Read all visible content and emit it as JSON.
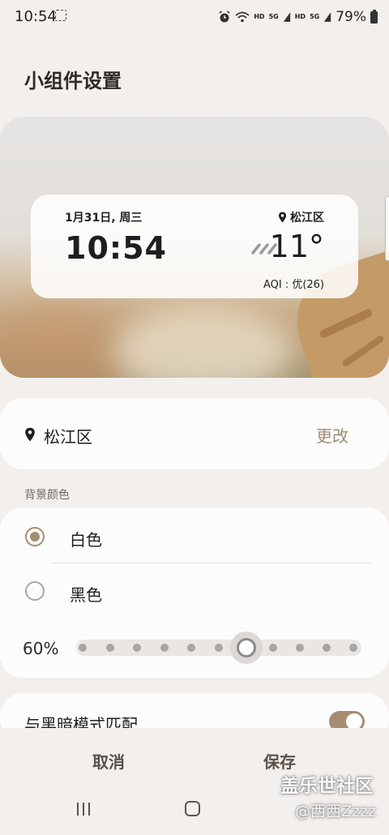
{
  "status_bar": {
    "time": "10:54",
    "hd1": "HD",
    "net1": "5G",
    "hd2": "HD",
    "net2": "5G",
    "battery": "79%"
  },
  "page": {
    "title": "小组件设置"
  },
  "preview": {
    "date": "1月31日, 周三",
    "location": "松江区",
    "time": "10:54",
    "temperature": "11°",
    "aqi": "AQI : 优(26)"
  },
  "location": {
    "name": "松江区",
    "change_label": "更改"
  },
  "background": {
    "section_label": "背景颜色",
    "options": [
      {
        "label": "白色",
        "selected": true
      },
      {
        "label": "黑色",
        "selected": false
      }
    ],
    "opacity_label": "60%",
    "opacity_value": 0.6
  },
  "dark_mode": {
    "label": "与黑暗模式匹配",
    "enabled": true
  },
  "actions": {
    "cancel": "取消",
    "save": "保存"
  },
  "watermark": {
    "line1": "盖乐世社区",
    "line2": "@西西Zzzz"
  },
  "colors": {
    "accent": "#a58d73",
    "change_link": "#9b8c77",
    "background": "#f2efed"
  }
}
